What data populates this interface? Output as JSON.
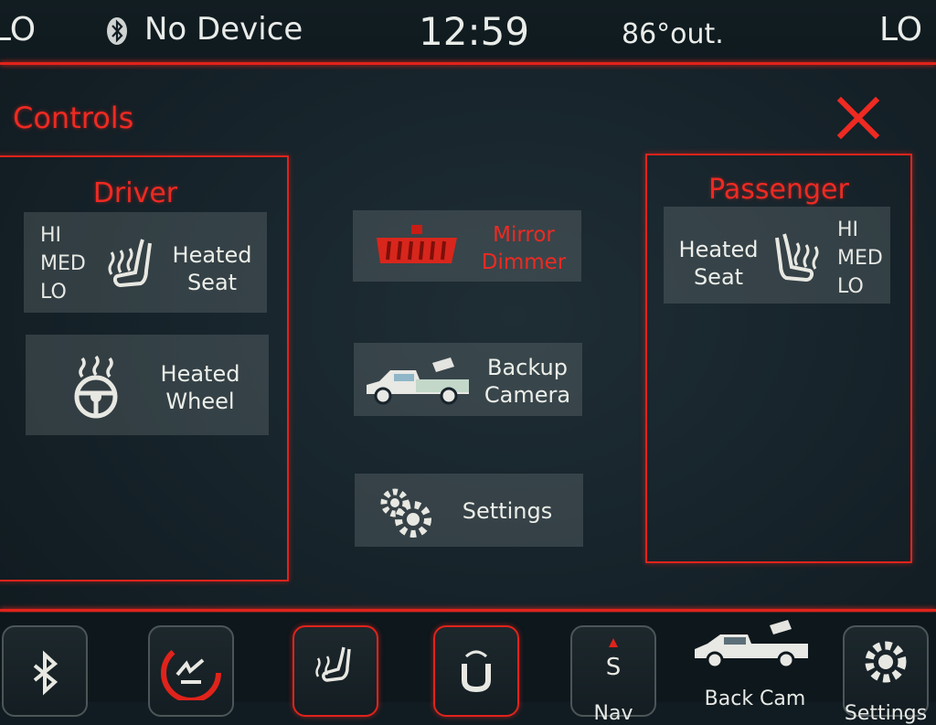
{
  "status_bar": {
    "left_mode": "LO",
    "bluetooth_icon": "bluetooth-icon",
    "device_status": "No Device",
    "time": "12:59",
    "outside_temp": "86°out.",
    "right_mode": "LO"
  },
  "header": {
    "title": "Controls",
    "close_icon": "close-icon"
  },
  "driver": {
    "title": "Driver",
    "heated_seat": {
      "levels": [
        "HI",
        "MED",
        "LO"
      ],
      "label_line1": "Heated",
      "label_line2": "Seat",
      "icon": "heated-seat-icon"
    },
    "heated_wheel": {
      "label_line1": "Heated",
      "label_line2": "Wheel",
      "icon": "heated-wheel-icon"
    }
  },
  "center": {
    "mirror_dimmer": {
      "label_line1": "Mirror",
      "label_line2": "Dimmer",
      "icon": "mirror-icon"
    },
    "backup_camera": {
      "label_line1": "Backup",
      "label_line2": "Camera",
      "icon": "truck-camera-icon"
    },
    "settings": {
      "label": "Settings",
      "icon": "gear-icon"
    }
  },
  "passenger": {
    "title": "Passenger",
    "heated_seat": {
      "levels": [
        "HI",
        "MED",
        "LO"
      ],
      "label_line1": "Heated",
      "label_line2": "Seat",
      "icon": "heated-seat-icon"
    }
  },
  "dock": {
    "items": [
      {
        "id": "bluetooth",
        "icon": "bluetooth-icon",
        "label": ""
      },
      {
        "id": "climate",
        "icon": "climate-icon",
        "label": ""
      },
      {
        "id": "seat",
        "icon": "heated-seat-icon",
        "label": ""
      },
      {
        "id": "uconnect",
        "icon": "uconnect-icon",
        "label": ""
      },
      {
        "id": "nav",
        "icon": "compass-icon",
        "compass_letter": "S",
        "label": "Nav"
      },
      {
        "id": "backcam",
        "icon": "truck-camera-icon",
        "label": "Back Cam"
      },
      {
        "id": "settings",
        "icon": "gear-icon",
        "label": "Settings"
      }
    ]
  },
  "colors": {
    "accent_red": "#e0231b",
    "background": "#17242b",
    "text": "#e6e8e4"
  }
}
